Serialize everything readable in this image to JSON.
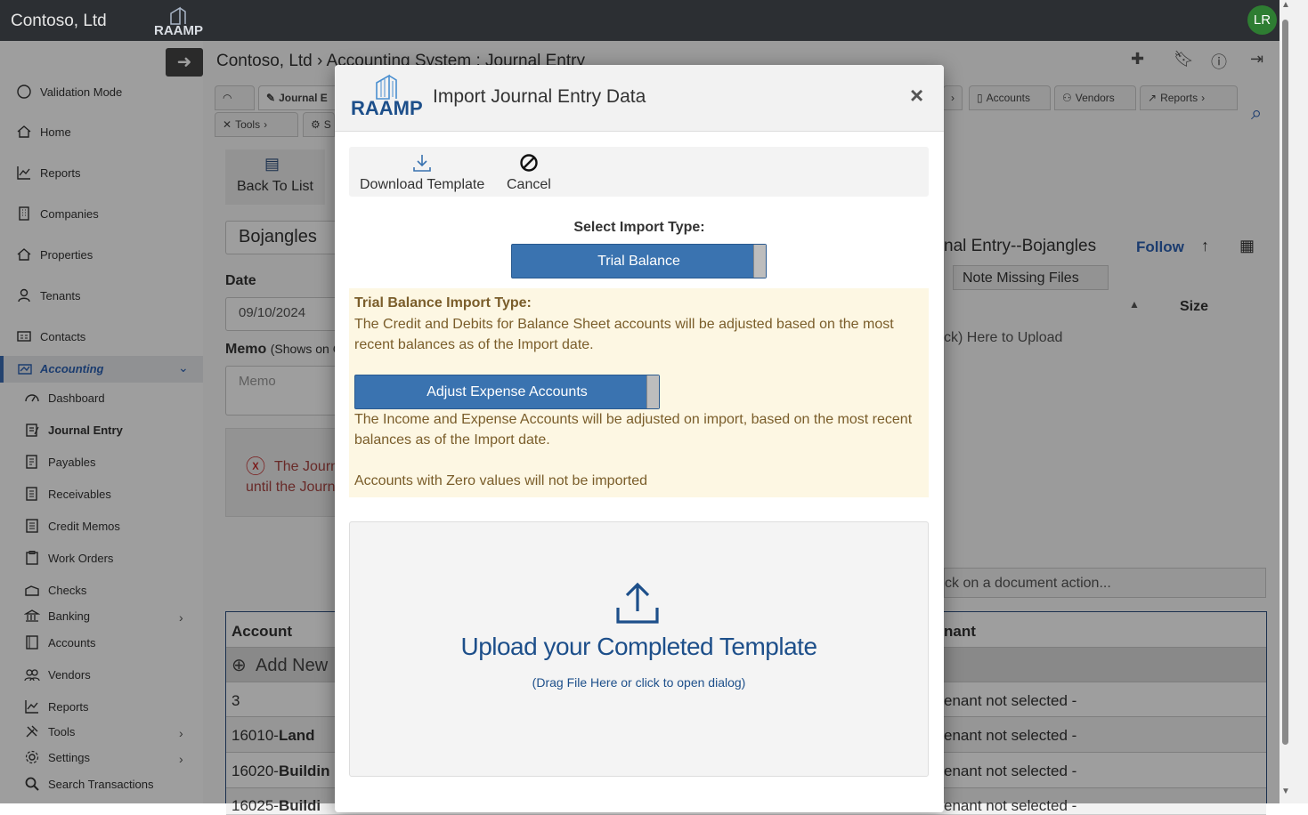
{
  "app": {
    "brand": "Contoso, Ltd",
    "logo_text": "RAAMP",
    "user_initials": "LR"
  },
  "breadcrumb": "Contoso, Ltd › Accounting System : Journal Entry",
  "sidebar": {
    "items": [
      {
        "label": "Validation Mode"
      },
      {
        "label": "Home"
      },
      {
        "label": "Reports"
      },
      {
        "label": "Companies"
      },
      {
        "label": "Properties"
      },
      {
        "label": "Tenants"
      },
      {
        "label": "Contacts"
      },
      {
        "label": "Accounting"
      },
      {
        "label": "Dashboard"
      },
      {
        "label": "Journal Entry"
      },
      {
        "label": "Payables"
      },
      {
        "label": "Receivables"
      },
      {
        "label": "Credit Memos"
      },
      {
        "label": "Work Orders"
      },
      {
        "label": "Checks"
      },
      {
        "label": "Banking"
      },
      {
        "label": "Accounts"
      },
      {
        "label": "Vendors"
      },
      {
        "label": "Reports"
      },
      {
        "label": "Tools"
      },
      {
        "label": "Settings"
      },
      {
        "label": "Search Transactions"
      }
    ]
  },
  "tabs": {
    "journal": "Journal E",
    "accounts": "Accounts",
    "vendors": "Vendors",
    "reports": "Reports",
    "tools": "Tools",
    "settings": "S"
  },
  "form": {
    "back_to_list": "Back To List",
    "company": "Bojangles",
    "date_label": "Date",
    "date_value": "09/10/2024",
    "memo_label": "Memo",
    "memo_note": "(Shows on C",
    "memo_placeholder": "Memo",
    "error_line1": "The Journ",
    "error_line2": "until the Journ"
  },
  "right_panel": {
    "title": "nal Entry--Bojangles",
    "follow": "Follow",
    "note_missing": "Note Missing Files",
    "size": "Size",
    "upload_hint": "ck) Here to Upload",
    "doc_action": "ck on a document action..."
  },
  "grid": {
    "header_account": "Account",
    "header_tenant": "nant",
    "add_new": "Add New",
    "rows": [
      {
        "account": "3",
        "account_bold": "",
        "tenant": "enant not selected -"
      },
      {
        "account": "16010-",
        "account_bold": "Land",
        "tenant": "enant not selected -"
      },
      {
        "account": "16020-",
        "account_bold": "Buildin",
        "tenant": "enant not selected -"
      },
      {
        "account": "16025-",
        "account_bold": "Buildi",
        "tenant": "enant not selected -"
      }
    ]
  },
  "modal": {
    "title": "Import Journal Entry Data",
    "logo_text": "RAAMP",
    "download_template": "Download Template",
    "cancel": "Cancel",
    "select_import_type": "Select Import Type:",
    "import_type_value": "Trial Balance",
    "info_heading": "Trial Balance Import Type:",
    "info_text1": "The Credit and Debits for Balance Sheet accounts will be adjusted based on the most recent balances as of the Import date.",
    "adjust_button": "Adjust Expense Accounts",
    "info_text2": "The Income and Expense Accounts will be adjusted on import, based on the most recent balances as of the Import date.",
    "info_text3": "Accounts with Zero values will not be imported",
    "upload_title": "Upload your Completed Template",
    "upload_sub": "(Drag File Here or click to open dialog)"
  },
  "colors": {
    "topbar": "#2c2f33",
    "accent_blue": "#3a73b0",
    "info_bg": "#fdf7e3",
    "info_text": "#7a5d2a",
    "upload_text": "#1d4f8a",
    "avatar": "#2e7d32"
  }
}
